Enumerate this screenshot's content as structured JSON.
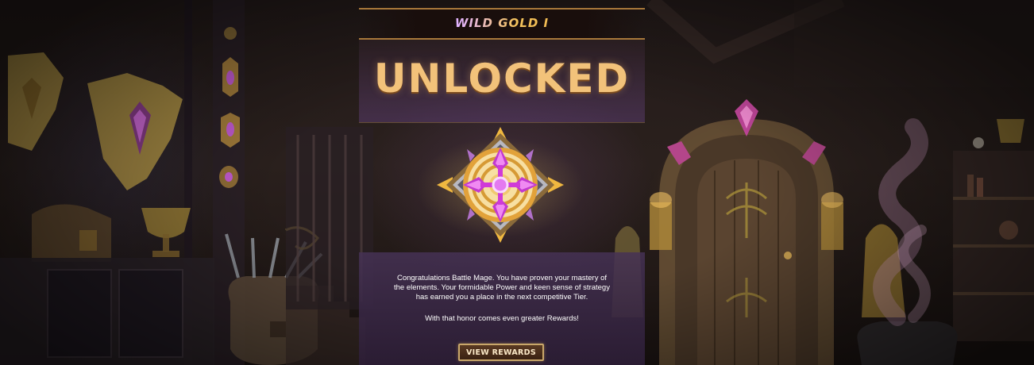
{
  "tier": {
    "label": "WILD GOLD I"
  },
  "headline": {
    "text": "UNLOCKED"
  },
  "message": {
    "line1": "Congratulations Battle Mage. You have proven your mastery of",
    "line2": "the elements. Your formidable Power and keen sense of strategy",
    "line3": "has earned you a place in the next competitive Tier.",
    "line4": "With that honor comes even greater Rewards!"
  },
  "actions": {
    "view_rewards": "VIEW REWARDS"
  },
  "colors": {
    "accent_gold": "#f2c27a",
    "accent_purple": "#c07bf0",
    "border_gold": "#c9a76a"
  },
  "icons": {
    "emblem": "gold-tier-emblem-icon"
  }
}
